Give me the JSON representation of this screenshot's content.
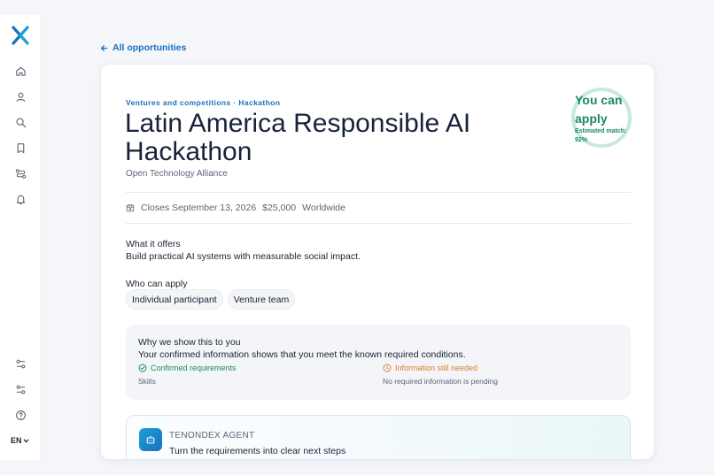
{
  "nav": {
    "back_label": "All opportunities",
    "items": [
      {
        "name": "home-icon"
      },
      {
        "name": "user-icon"
      },
      {
        "name": "search-icon"
      },
      {
        "name": "bookmark-icon"
      },
      {
        "name": "route-icon"
      },
      {
        "name": "bell-icon"
      }
    ],
    "bottom_items": [
      {
        "name": "filters-icon"
      },
      {
        "name": "sliders-icon"
      },
      {
        "name": "help-icon"
      }
    ],
    "language": "EN"
  },
  "opportunity": {
    "eyebrow": "Ventures and competitions · Hackathon",
    "title": "Latin America Responsible AI Hackathon",
    "organization": "Open Technology Alliance",
    "match": {
      "title": "You can apply",
      "subtitle": "Estimated match: 92%"
    },
    "meta": {
      "closes": "Closes September 13, 2026",
      "amount": "$25,000",
      "location": "Worldwide"
    },
    "offers": {
      "label": "What it offers",
      "text": "Build practical AI systems with measurable social impact."
    },
    "who": {
      "label": "Who can apply",
      "chips": [
        "Individual participant",
        "Venture team"
      ]
    },
    "why": {
      "title": "Why we show this to you",
      "text": "Your confirmed information shows that you meet the known required conditions.",
      "confirmed_label": "Confirmed requirements",
      "confirmed_sub": "Skills",
      "needed_label": "Information still needed",
      "needed_sub": "No required information is pending"
    },
    "agent": {
      "name": "TENONDEX AGENT",
      "text": "Turn the requirements into clear next steps"
    }
  },
  "colors": {
    "accent": "#1a6fbf",
    "success": "#1b8a5e",
    "warning": "#d9801f",
    "brand": "#1aa0d8"
  }
}
